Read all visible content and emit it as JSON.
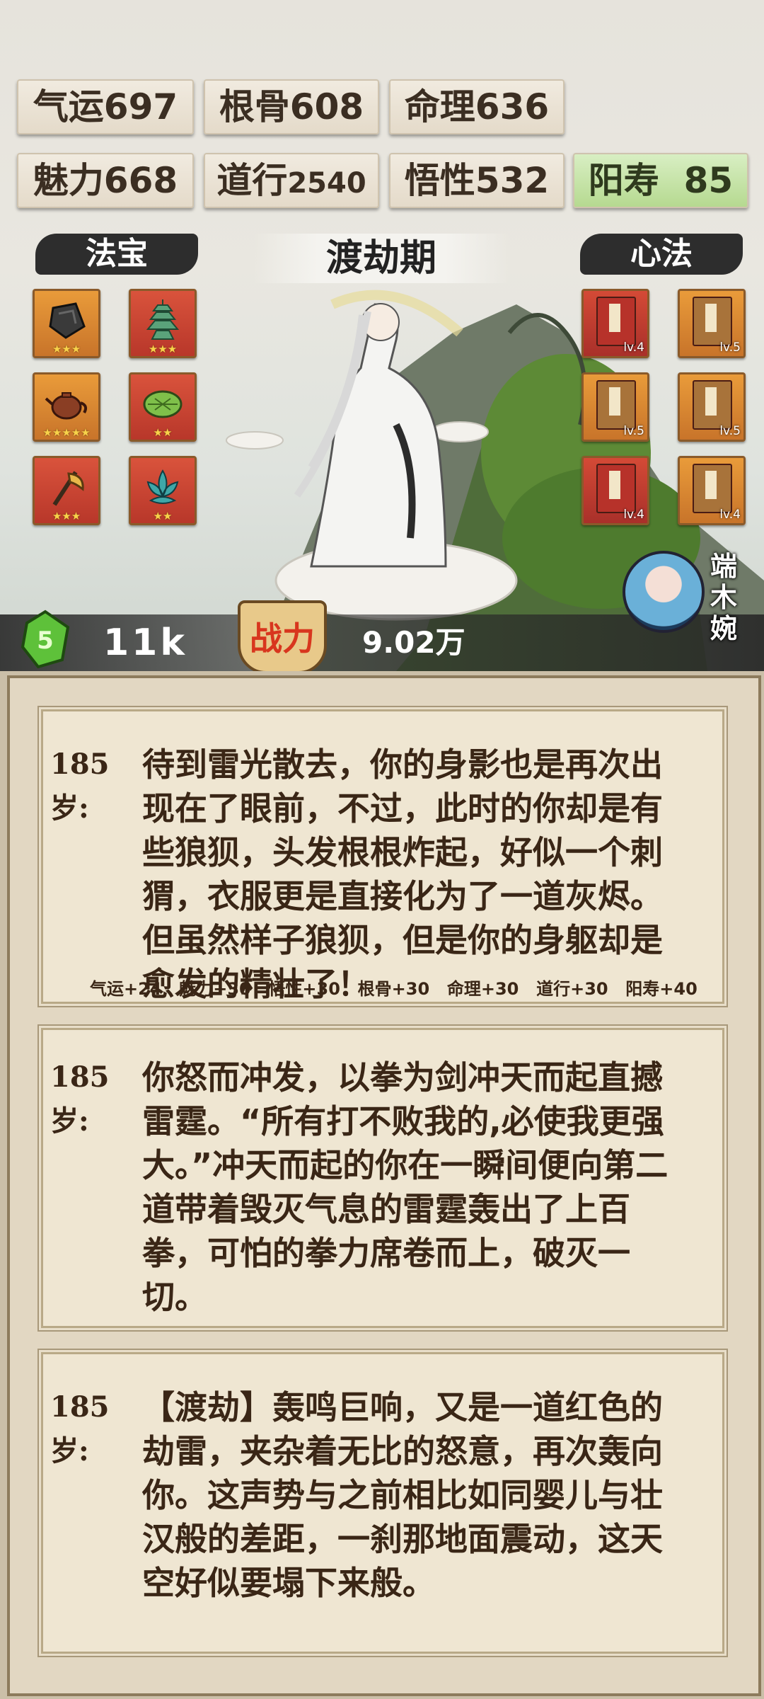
{
  "stats": {
    "qiyun": "气运697",
    "gengu": "根骨608",
    "mingli": "命理636",
    "meili": "魅力668",
    "daoxing_label": "道行",
    "daoxing_value": "2540",
    "wuxing": "悟性532",
    "yangshou": "阳寿  85"
  },
  "banners": {
    "fabao": "法宝",
    "realm": "渡劫期",
    "xinfa": "心法"
  },
  "fabao_items": [
    {
      "icon": "stone-icon",
      "stars": "★★★"
    },
    {
      "icon": "pagoda-icon",
      "stars": "★★★"
    },
    {
      "icon": "teapot-icon",
      "stars": "★★★★★"
    },
    {
      "icon": "leaf-dish-icon",
      "stars": "★★"
    },
    {
      "icon": "axe-icon",
      "stars": "★★★"
    },
    {
      "icon": "lotus-icon",
      "stars": "★★"
    }
  ],
  "xinfa_books": [
    {
      "level": "lv.4",
      "color": "#b7322a"
    },
    {
      "level": "lv.5",
      "color": "#a8733a"
    },
    {
      "level": "lv.5",
      "color": "#a8733a"
    },
    {
      "level": "lv.5",
      "color": "#a8733a"
    },
    {
      "level": "lv.4",
      "color": "#b7322a"
    },
    {
      "level": "lv.4",
      "color": "#a8733a"
    }
  ],
  "companion": {
    "name": "端木婉"
  },
  "bottom": {
    "spirit_stones": "11k",
    "power_label": "战力",
    "power_value": "9.02万"
  },
  "log": [
    {
      "age": "185岁:",
      "text": "待到雷光散去，你的身影也是再次出现在了眼前，不过，此时的你却是有些狼狈，头发根根炸起，好似一个刺猬，衣服更是直接化为了一道灰烬。但虽然样子狼狈，但是你的身躯却是愈发的精壮了！",
      "gains": "气运+24  魅力+30  悟性+30  根骨+30  命理+30  道行+30  阳寿+40"
    },
    {
      "age": "185岁:",
      "text": "你怒而冲发，以拳为剑冲天而起直撼雷霆。“所有打不败我的,必使我更强大。”冲天而起的你在一瞬间便向第二道带着毁灭气息的雷霆轰出了上百拳，可怕的拳力席卷而上，破灭一切。"
    },
    {
      "age": "185岁:",
      "text": "【渡劫】轰鸣巨响，又是一道红色的劫雷，夹杂着无比的怒意，再次轰向你。这声势与之前相比如同婴儿与壮汉般的差距，一刹那地面震动，这天空好似要塌下来般。"
    }
  ]
}
